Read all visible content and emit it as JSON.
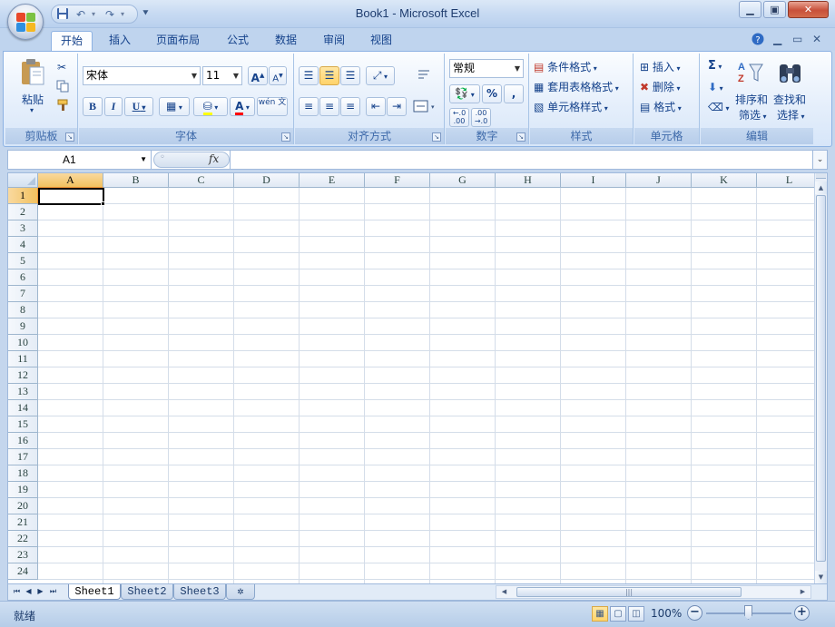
{
  "window": {
    "title": "Book1 - Microsoft Excel"
  },
  "qat": {
    "save_icon": "save-icon",
    "undo_icon": "undo-icon",
    "redo_icon": "redo-icon"
  },
  "tabs": [
    "开始",
    "插入",
    "页面布局",
    "公式",
    "数据",
    "审阅",
    "视图"
  ],
  "ribbon": {
    "clipboard": {
      "label": "剪贴板",
      "paste": "粘贴"
    },
    "font": {
      "label": "字体",
      "font_name": "宋体",
      "font_size": "11",
      "bold": "B",
      "italic": "I",
      "underline": "U",
      "font_color_glyph": "A",
      "grow": "A",
      "shrink": "A",
      "phonetic": "wén 文"
    },
    "alignment": {
      "label": "对齐方式"
    },
    "number": {
      "label": "数字",
      "format": "常规",
      "percent": "%",
      "comma": ","
    },
    "styles": {
      "label": "样式",
      "conditional": "条件格式",
      "table": "套用表格格式",
      "cell_styles": "单元格样式"
    },
    "cells": {
      "label": "单元格",
      "insert": "插入",
      "delete": "删除",
      "format": "格式"
    },
    "editing": {
      "label": "编辑",
      "sum": "Σ",
      "sort_line1": "排序和",
      "sort_line2": "筛选",
      "find_line1": "查找和",
      "find_line2": "选择"
    }
  },
  "formula_bar": {
    "name_box": "A1",
    "fx": "fx",
    "formula": ""
  },
  "grid": {
    "columns": [
      "A",
      "B",
      "C",
      "D",
      "E",
      "F",
      "G",
      "H",
      "I",
      "J",
      "K",
      "L"
    ],
    "rows": [
      "1",
      "2",
      "3",
      "4",
      "5",
      "6",
      "7",
      "8",
      "9",
      "10",
      "11",
      "12",
      "13",
      "14",
      "15",
      "16",
      "17",
      "18",
      "19",
      "20",
      "21",
      "22",
      "23",
      "24"
    ],
    "active_cell": "A1"
  },
  "sheets": [
    "Sheet1",
    "Sheet2",
    "Sheet3"
  ],
  "status": {
    "text": "就绪",
    "zoom": "100%"
  },
  "colors": {
    "accent": "#15428b",
    "selection": "#f1c15f"
  }
}
